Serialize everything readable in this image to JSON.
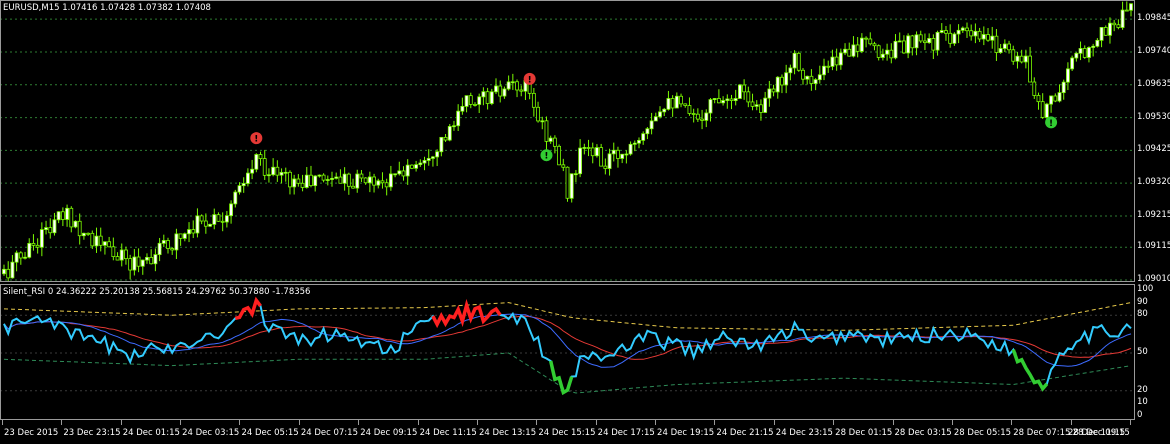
{
  "main_chart": {
    "header": "EURUSD,M15  1.07416 1.07428 1.07382 1.07408",
    "price_levels": [
      "1.09845",
      "1.09740",
      "1.09635",
      "1.09530",
      "1.09425",
      "1.09320",
      "1.09215",
      "1.09115",
      "1.09010"
    ],
    "colors": {
      "background": "#000000",
      "grid": "#2e7d32",
      "bull": "#ffffff",
      "bear": "#000000",
      "candle_outline": "#7CFC00"
    },
    "signals": [
      {
        "index": 60,
        "kind": "sell",
        "text": "!",
        "color": "#e53935"
      },
      {
        "index": 125,
        "kind": "sell",
        "text": "!",
        "color": "#e53935"
      },
      {
        "index": 129,
        "kind": "buy",
        "text": "!",
        "color": "#32cd32"
      },
      {
        "index": 249,
        "kind": "buy",
        "text": "!",
        "color": "#32cd32"
      }
    ]
  },
  "indicator": {
    "header": "Silent_RSI 0 24.36222 25.20138 25.56815 24.29762 50.37880 -1.78356",
    "levels": [
      "100",
      "90",
      "80",
      "50",
      "20",
      "10",
      "0"
    ],
    "colors": {
      "rsi": "#33ccff",
      "overbought": "#ff2020",
      "oversold": "#32cd32",
      "signal": "#e53935",
      "avg": "#3d6bff",
      "ob_band": "#e6c84a",
      "os_band": "#2e8b57"
    }
  },
  "time_axis": [
    "23 Dec 2015",
    "23 Dec 23:15",
    "24 Dec 01:15",
    "24 Dec 03:15",
    "24 Dec 05:15",
    "24 Dec 07:15",
    "24 Dec 09:15",
    "24 Dec 11:15",
    "24 Dec 13:15",
    "24 Dec 15:15",
    "24 Dec 17:15",
    "24 Dec 19:15",
    "24 Dec 21:15",
    "24 Dec 23:15",
    "28 Dec 01:15",
    "28 Dec 03:15",
    "28 Dec 05:15",
    "28 Dec 07:15",
    "28 Dec 09:15",
    "28 Dec 11:15"
  ],
  "chart_data": [
    {
      "type": "candlestick",
      "symbol": "EURUSD",
      "timeframe": "M15",
      "ylim": [
        1.0901,
        1.099
      ],
      "close_path": [
        [
          0,
          1.0903
        ],
        [
          10,
          1.0917
        ],
        [
          15,
          1.0922
        ],
        [
          22,
          1.0913
        ],
        [
          30,
          1.0906
        ],
        [
          38,
          1.0911
        ],
        [
          45,
          1.0919
        ],
        [
          52,
          1.0922
        ],
        [
          57,
          1.0931
        ],
        [
          60,
          1.094
        ],
        [
          63,
          1.0936
        ],
        [
          70,
          1.0932
        ],
        [
          78,
          1.0934
        ],
        [
          86,
          1.0933
        ],
        [
          92,
          1.0933
        ],
        [
          100,
          1.0941
        ],
        [
          106,
          1.0948
        ],
        [
          110,
          1.0958
        ],
        [
          116,
          1.096
        ],
        [
          120,
          1.0962
        ],
        [
          124,
          1.0962
        ],
        [
          127,
          1.0953
        ],
        [
          131,
          1.0943
        ],
        [
          134,
          1.093
        ],
        [
          138,
          1.0944
        ],
        [
          143,
          1.0938
        ],
        [
          148,
          1.0943
        ],
        [
          153,
          1.0952
        ],
        [
          158,
          1.096
        ],
        [
          164,
          1.0952
        ],
        [
          170,
          1.096
        ],
        [
          176,
          1.0962
        ],
        [
          180,
          1.0955
        ],
        [
          184,
          1.0964
        ],
        [
          188,
          1.0973
        ],
        [
          192,
          1.0963
        ],
        [
          197,
          1.097
        ],
        [
          202,
          1.0977
        ],
        [
          208,
          1.0974
        ],
        [
          214,
          1.0976
        ],
        [
          220,
          1.0977
        ],
        [
          226,
          1.098
        ],
        [
          232,
          1.0978
        ],
        [
          238,
          1.0976
        ],
        [
          243,
          1.097
        ],
        [
          247,
          1.0955
        ],
        [
          251,
          1.0962
        ],
        [
          255,
          1.0972
        ],
        [
          260,
          1.0979
        ],
        [
          266,
          1.0985
        ],
        [
          268,
          1.099
        ]
      ]
    },
    {
      "type": "line",
      "name": "Silent_RSI",
      "ylim": [
        0,
        100
      ],
      "rsi_path": [
        [
          0,
          70
        ],
        [
          10,
          80
        ],
        [
          15,
          65
        ],
        [
          22,
          60
        ],
        [
          30,
          48
        ],
        [
          38,
          54
        ],
        [
          45,
          60
        ],
        [
          52,
          68
        ],
        [
          57,
          82
        ],
        [
          60,
          88
        ],
        [
          63,
          70
        ],
        [
          70,
          60
        ],
        [
          78,
          65
        ],
        [
          86,
          60
        ],
        [
          92,
          52
        ],
        [
          100,
          74
        ],
        [
          106,
          78
        ],
        [
          110,
          82
        ],
        [
          116,
          80
        ],
        [
          120,
          80
        ],
        [
          124,
          78
        ],
        [
          127,
          58
        ],
        [
          131,
          35
        ],
        [
          134,
          18
        ],
        [
          138,
          50
        ],
        [
          143,
          45
        ],
        [
          148,
          55
        ],
        [
          153,
          62
        ],
        [
          158,
          58
        ],
        [
          164,
          52
        ],
        [
          170,
          62
        ],
        [
          176,
          58
        ],
        [
          180,
          55
        ],
        [
          184,
          62
        ],
        [
          188,
          70
        ],
        [
          192,
          58
        ],
        [
          197,
          62
        ],
        [
          202,
          66
        ],
        [
          208,
          60
        ],
        [
          214,
          62
        ],
        [
          220,
          64
        ],
        [
          226,
          66
        ],
        [
          232,
          62
        ],
        [
          238,
          55
        ],
        [
          243,
          40
        ],
        [
          247,
          22
        ],
        [
          251,
          50
        ],
        [
          255,
          62
        ],
        [
          260,
          66
        ],
        [
          266,
          68
        ],
        [
          268,
          75
        ]
      ],
      "ob_band_path": [
        [
          0,
          85
        ],
        [
          40,
          80
        ],
        [
          70,
          85
        ],
        [
          100,
          86
        ],
        [
          120,
          90
        ],
        [
          135,
          78
        ],
        [
          160,
          70
        ],
        [
          200,
          68
        ],
        [
          240,
          72
        ],
        [
          268,
          90
        ]
      ],
      "os_band_path": [
        [
          0,
          45
        ],
        [
          40,
          40
        ],
        [
          70,
          45
        ],
        [
          100,
          45
        ],
        [
          120,
          50
        ],
        [
          135,
          18
        ],
        [
          160,
          25
        ],
        [
          200,
          30
        ],
        [
          240,
          25
        ],
        [
          268,
          40
        ]
      ]
    }
  ]
}
